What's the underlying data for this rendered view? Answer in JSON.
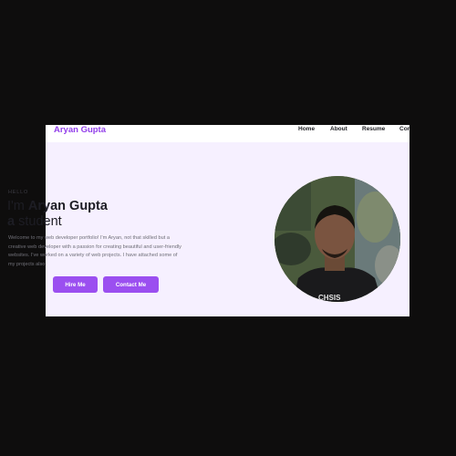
{
  "nav": {
    "brand": "Aryan Gupta",
    "links": [
      "Home",
      "About",
      "Resume",
      "Cor"
    ]
  },
  "hero": {
    "kicker": "HELLO",
    "title_line1_prefix": "I'm ",
    "title_name": "Aryan Gupta",
    "title_line2_bold": "a",
    "title_line2_rest": " student",
    "description": "Welcome to my web developer portfolio! I'm Aryan, not that skilled but a creative web developer with a passion for creating beautiful and user-friendly websites. I've worked on a variety of web projects. I have attached some of my projects also.",
    "hire_button": "Hire Me",
    "contact_button": "Contact Me",
    "shirt_text": "CHSIS"
  },
  "colors": {
    "accent": "#9b4ff0",
    "brand": "#9340ea",
    "hero_bg": "#f6f0ff"
  }
}
